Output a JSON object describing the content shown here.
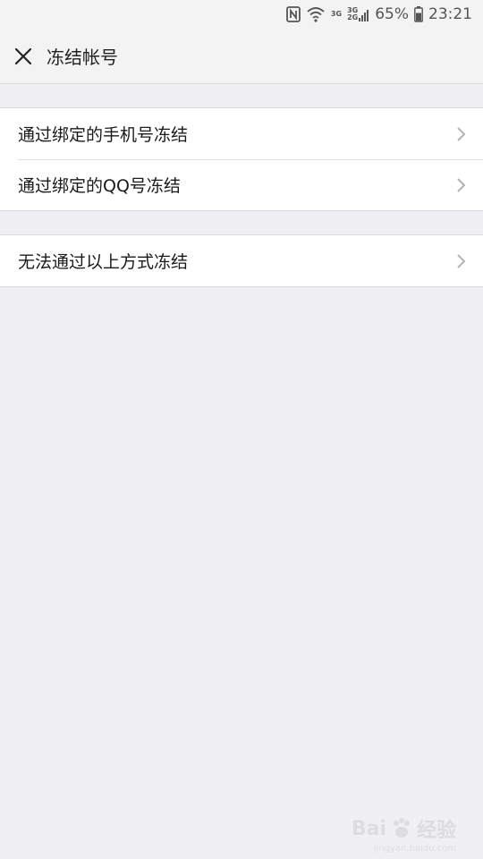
{
  "status_bar": {
    "battery_percent": "65%",
    "time": "23:21",
    "network_labels": [
      "3G",
      "3G",
      "2G"
    ],
    "icons": [
      "nfc-icon",
      "wifi-icon",
      "signal-icon",
      "battery-icon"
    ],
    "battery_level": 0.65
  },
  "header": {
    "title": "冻结帐号",
    "close_icon": "close-icon"
  },
  "groups": [
    {
      "items": [
        {
          "label": "通过绑定的手机号冻结"
        },
        {
          "label": "通过绑定的QQ号冻结"
        }
      ]
    },
    {
      "items": [
        {
          "label": "无法通过以上方式冻结"
        }
      ]
    }
  ],
  "watermark": {
    "text": "Bai",
    "text2": "经验",
    "sub": "jingyan.baidu.com"
  },
  "colors": {
    "background": "#efeff4",
    "bar": "#f3f3f3",
    "row_bg": "#ffffff",
    "chevron": "#b3b3b3"
  }
}
